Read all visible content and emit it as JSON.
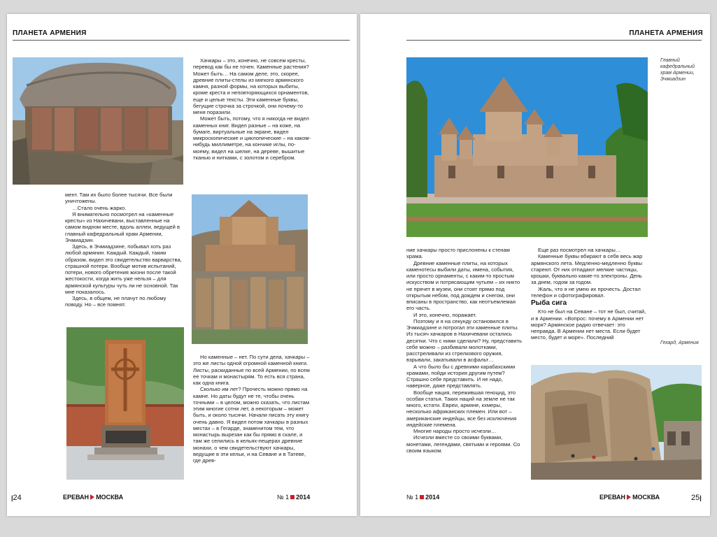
{
  "left": {
    "header": "ПЛАНЕТА АРМЕНИЯ",
    "col1_paras": [
      "мент. Там их было более тысячи. Все были уничтожены.",
      "…Стало очень жарко.",
      "Я внимательно посмотрел на «каменные кресты» из Нахичевани, выставленные на самом видном месте, вдоль аллеи, ведущей в главный кафедральный храм Армении, Эчмиадзин.",
      "Здесь, в Эчмиадзине, побывал хоть раз любой армянин. Каждый. Каждый, таким образом, видел это свидетельство варварства, страшной потери. Вообще мотив испытаний, потери, нового обретения жизни после такой жестокости, когда жить уже нельзя – для армянской культуры чуть ли не основной. Так мне показалось.",
      "Здесь, в общем, не плачут по любому поводу. Но – все помнят."
    ],
    "col2_top_paras": [
      "Хачкары – это, конечно, не совсем кресты, перевод как бы не точен. Каменные растения? Может быть… На самом деле, это, скорее, древние плиты-стелы из мягкого армянского камня, разной формы, на которых выбиты, кроме креста и неповторяющихся орнаментов, еще и целые тексты. Эти каменные буквы, бегущие строчка за строчкой, они почему-то меня поразили.",
      "Может быть, потому, что я никогда не видел каменных книг. Видел разные – на коже, на бумаге, виртуальные на экране, видел микроскопические и циклопические – на каком-нибудь миллиметре, на кончике иглы, по-моему, видел на шелке, на дереве, вышитые тканью и нитками, с золотом и серебром."
    ],
    "col2_bottom_paras": [
      "Но каменные – нет. По сути дела, хачкары – это же листы одной огромной каменной книги. Листы, раскиданные по всей Армении, по всем ее точкам и монастырям. То есть вся страна, как одна книга.",
      "Сколько им лет? Прочесть можно прямо на камне. Но даты будут не те, чтобы очень точными – в целом, можно сказать, что листам этим многие сотни лет, а некоторым – может быть, и около тысячи. Начали писать эту книгу очень давно. Я видел потом хачкары в разных местах – в Гегарде, знаменитом тем, что монастырь вырезан как бы прямо в скале, и там же селились в кельях-пещерах древние монахи, о чем свидетельствуют хачкары, ведущие в эти кельи, и на Севане и в Татеве, где древ-"
    ],
    "footer": {
      "page": "24",
      "brand1": "ЕРЕВАН",
      "brand2": "МОСКВА",
      "issue": "№ 1",
      "year": "2014"
    }
  },
  "right": {
    "header": "ПЛАНЕТА АРМЕНИЯ",
    "caption1": "Главный кафедральный храм Армении, Эчмиадзин",
    "caption2": "Гехард, Армения",
    "col1_paras": [
      "ние хачкары просто прислонены к стенам храма.",
      "Древние каменные плиты, на которых каменотесы выбили даты, имена, события, или просто орнаменты, с каким-то простым искусством и потрясающим чутьем – их никто не прячет в музеи, они стоят прямо под открытым небом, под дождем и снегом, они вписаны в пространство, как неотъемлемая его часть.",
      "И это, конечно, поражает.",
      "Поэтому и я на секунду остановился в Эчмиадзине и потрогал эти каменные плиты. Из тысяч хачкаров в Нахичевани остались десятки. Что с ними сделали? Ну, представить себе можно – разбивали молотками, расстреливали из стрелкового оружия, взрывали, закатывали в асфальт…",
      "А что было бы с древними карабахскими храмами, пойди история другим путем? Страшно себе представить. И не надо, наверное, даже представлять.",
      "Вообще нация, пережившая геноцид, это особая статья. Таких наций на земле не так много, кстати. Евреи, армяне, кхмеры, несколько африканских племен. Или вот – американские индейцы, все без исключения индейские племена.",
      "Многие народы просто исчезли…",
      "Исчезли вместе со своими буквами, монетами, легендами, святыми и героями. Со своим языком."
    ],
    "col2_paras": [
      "Еще раз посмотрел на хачкары…",
      "Каменные буквы вбирают в себя весь жар армянского лета. Медленно-медленно буквы стареют. От них отпадают мелкие частицы, крошки, буквально какие-то электроны. День за днем, годом за годом.",
      "Жаль, что я не умею их прочесть. Достал телефон и сфотографировал."
    ],
    "subhead": "Рыба сига",
    "col2_after_paras": [
      "Кто не был на Севане – тот не был, считай, и в Армении. «Вопрос: почему в Армении нет моря? Армянское радио отвечает: это неправда. В Армении нет места. Если будет место, будет и море». Последний"
    ],
    "footer": {
      "page": "25",
      "brand1": "ЕРЕВАН",
      "brand2": "МОСКВА",
      "issue": "№ 1",
      "year": "2014"
    }
  }
}
